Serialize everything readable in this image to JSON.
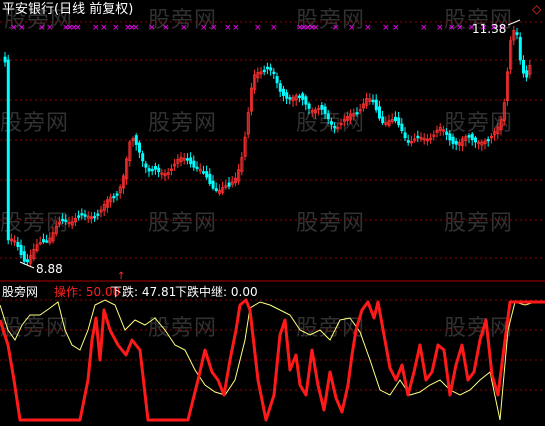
{
  "title": "平安银行(日线 前复权)",
  "price_high_label": "11.38",
  "price_low_label": "8.88",
  "indicator": {
    "name": "股旁网",
    "items": [
      {
        "label": "操作:",
        "value": "50.00",
        "color": "#ff2020"
      },
      {
        "label": "下跌:",
        "value": "47.81",
        "color": "#ffffff"
      },
      {
        "label": "下跌中继:",
        "value": "0.00",
        "color": "#ffffff"
      }
    ]
  },
  "watermark": "股旁网",
  "markers": {
    "magenta_x": "×",
    "top_right": "◇"
  },
  "colors": {
    "up": "#ff3030",
    "down": "#00ffff",
    "grid": "#8b0000",
    "line_yellow": "#ffff80",
    "line_red": "#ff1a1a",
    "marker": "#ff00ff"
  }
}
